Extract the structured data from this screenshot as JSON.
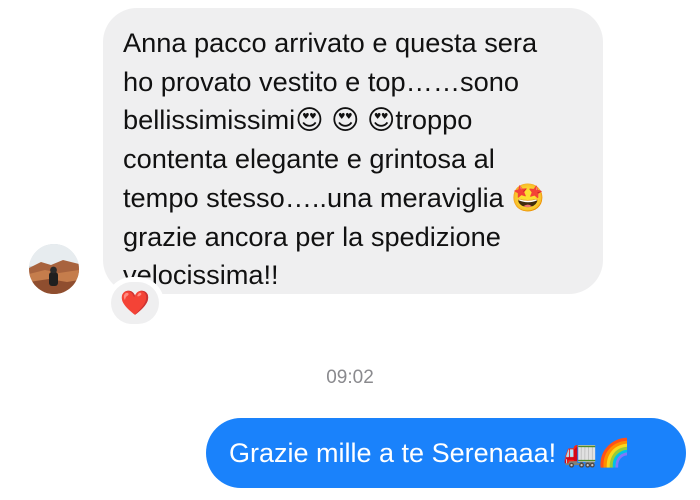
{
  "incoming_message": {
    "text": "Anna pacco arrivato e questa sera\nho provato vestito e top……sono\nbellissimissimi😍 😍 😍troppo\ncontenta elegante e grintosa al\ntempo stesso…..una meraviglia 🤩\ngrazie ancora per la spedizione\nvelocissima!!",
    "reaction": "❤️"
  },
  "timestamp": "09:02",
  "outgoing_message": {
    "text": "Grazie mille a te Serenaaa! 🚛🌈"
  },
  "colors": {
    "incoming_bubble": "#efeff0",
    "outgoing_bubble": "#1a82fb",
    "timestamp_text": "#8a8a8e"
  }
}
